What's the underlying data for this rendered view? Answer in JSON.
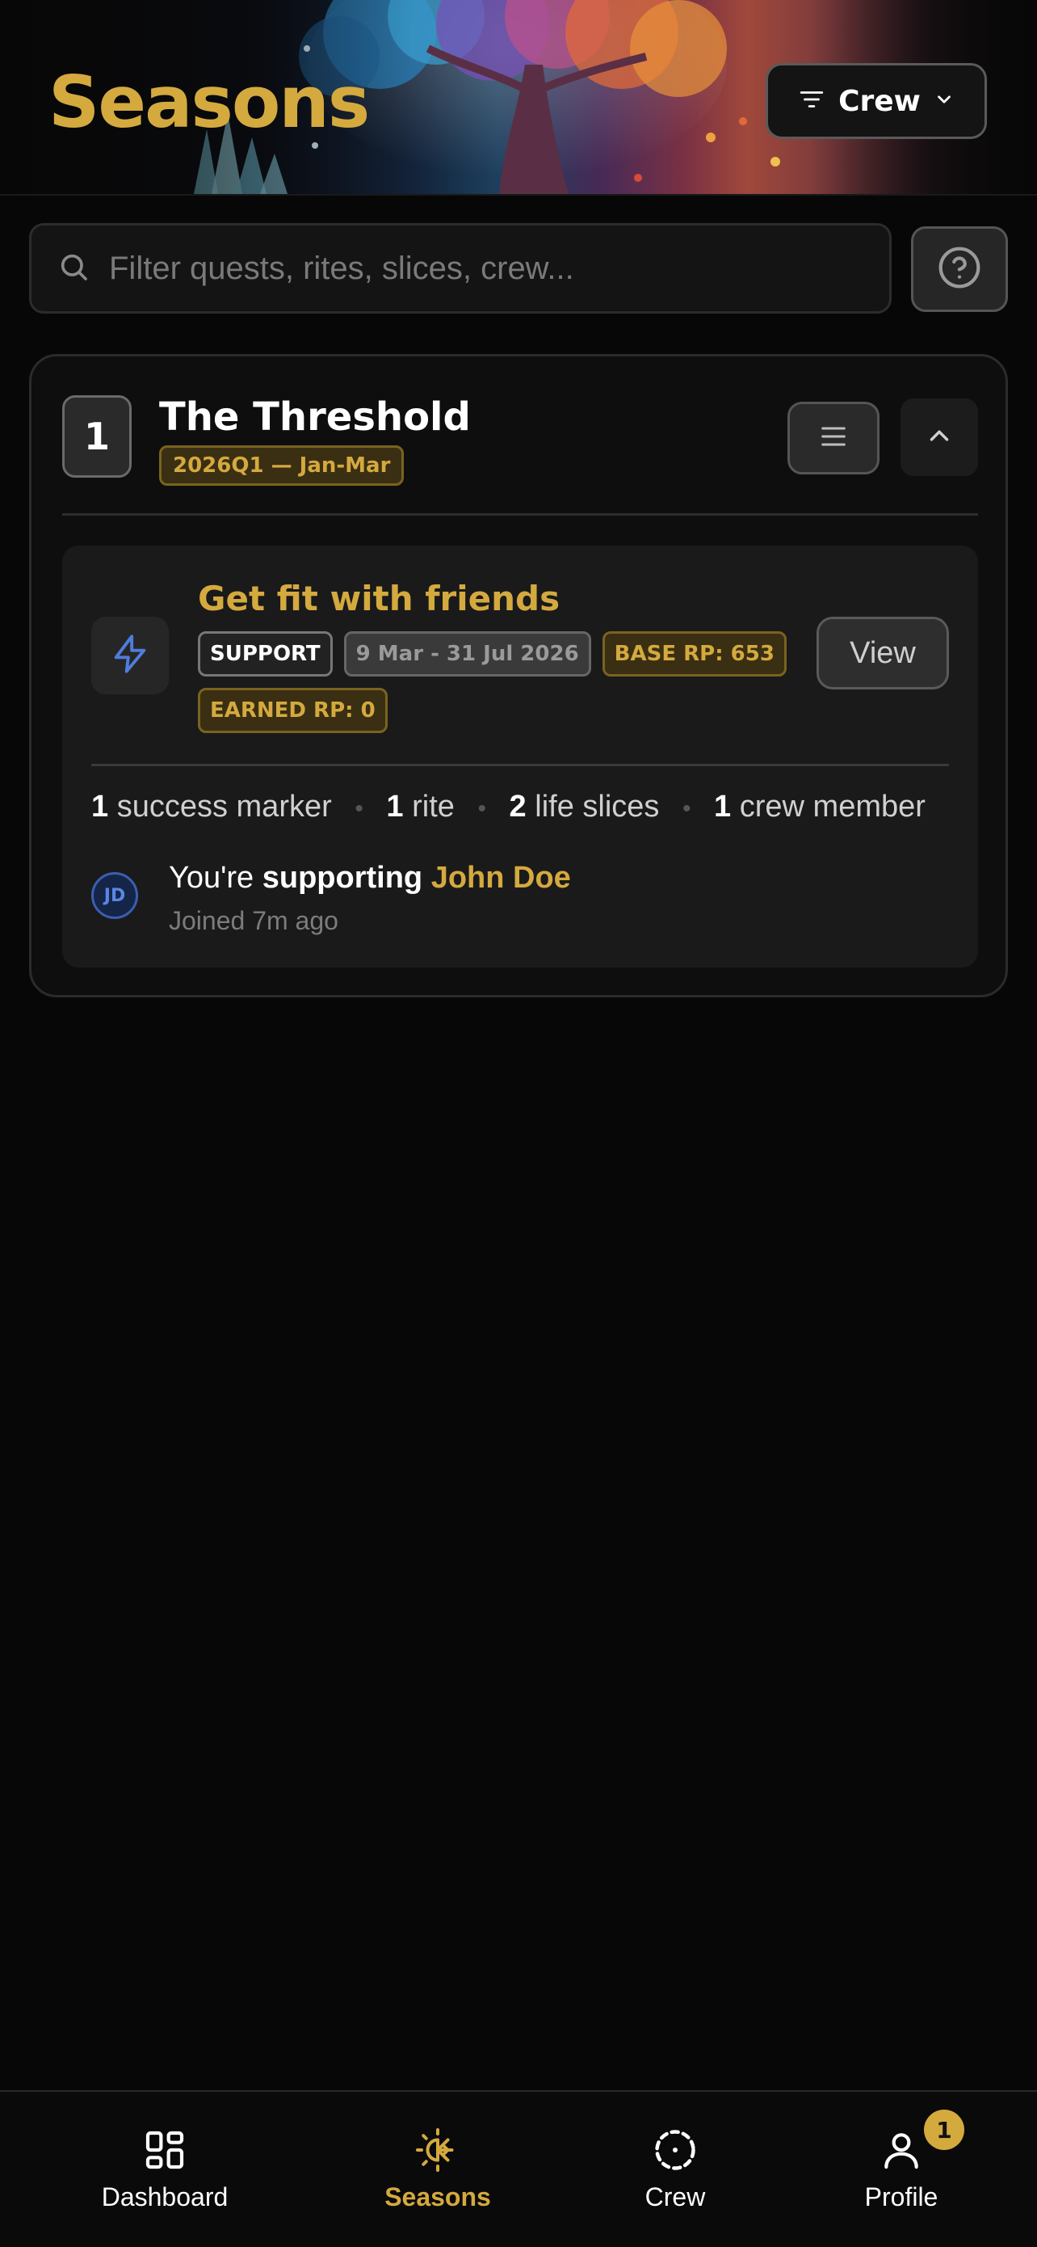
{
  "header": {
    "app_title": "Seasons",
    "filter_button_label": "Crew",
    "filter_icon": "filter-lines-icon",
    "filter_chevron_icon": "chevron-down-icon"
  },
  "search": {
    "placeholder": "Filter quests, rites, slices, crew...",
    "value": "",
    "icon": "search-icon",
    "help_icon": "help-circle-icon"
  },
  "season": {
    "number": "1",
    "title": "The Threshold",
    "tag": "2026Q1 — Jan-Mar",
    "menu_icon": "menu-icon",
    "collapse_icon": "chevron-up-icon",
    "quest": {
      "icon": "lightning-bolt-icon",
      "title": "Get fit with friends",
      "badges": {
        "role": "SUPPORT",
        "dates": "9 Mar - 31 Jul 2026",
        "base_rp": "BASE RP: 653",
        "earned_rp": "EARNED RP: 0"
      },
      "view_label": "View",
      "stats": {
        "markers_count": "1",
        "markers_label": "success marker",
        "rites_count": "1",
        "rites_label": "rite",
        "slices_count": "2",
        "slices_label": "life slices",
        "crew_count": "1",
        "crew_label": "crew member"
      },
      "supporter": {
        "avatar_initials": "JD",
        "prefix": "You're",
        "verb": "supporting",
        "name": "John Doe",
        "joined": "Joined 7m ago"
      }
    }
  },
  "bottom_nav": {
    "items": [
      {
        "label": "Dashboard",
        "icon": "dashboard-grid-icon"
      },
      {
        "label": "Seasons",
        "icon": "seasons-sun-snowflake-icon",
        "active": true
      },
      {
        "label": "Crew",
        "icon": "crew-dashed-circle-icon"
      },
      {
        "label": "Profile",
        "icon": "profile-person-icon",
        "badge": "1"
      }
    ]
  },
  "colors": {
    "accent": "#d4a93e",
    "background": "#070707",
    "card": "#0e0e0e",
    "quest_card": "#1a1a1a",
    "avatar_blue": "#5b86e6",
    "bolt_blue": "#4f7ddb"
  }
}
